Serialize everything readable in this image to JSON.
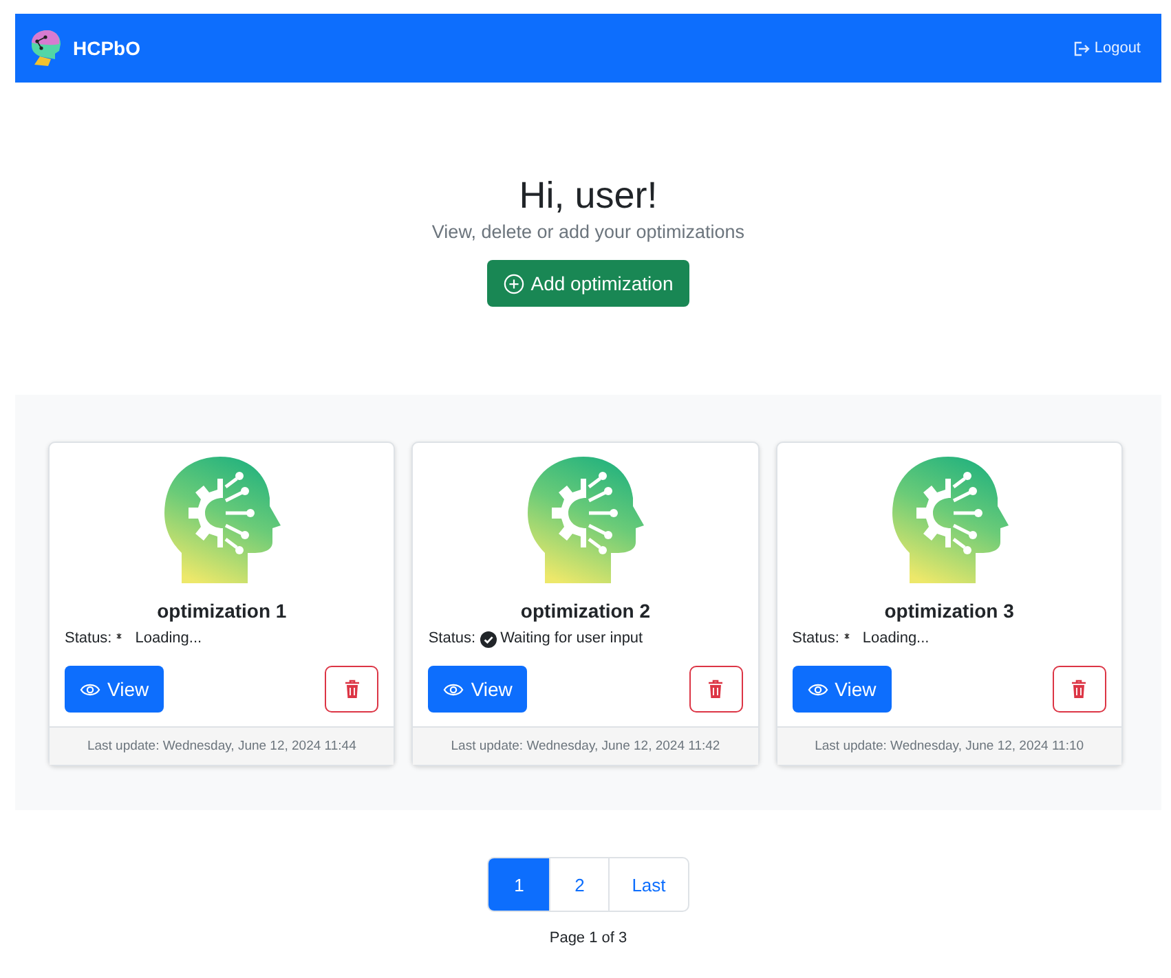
{
  "navbar": {
    "brand": "HCPbO",
    "logout": "Logout"
  },
  "header": {
    "title": "Hi, user!",
    "subtitle": "View, delete or add your optimizations",
    "add_button": "Add optimization"
  },
  "cards": [
    {
      "name": "optimization 1",
      "status_label": "Status:",
      "kind": "loading",
      "status": "Loading...",
      "view": "View",
      "updated": "Last update: Wednesday, June 12, 2024 11:44"
    },
    {
      "name": "optimization 2",
      "status_label": "Status:",
      "kind": "done",
      "status": "Waiting for user input",
      "view": "View",
      "updated": "Last update: Wednesday, June 12, 2024 11:42"
    },
    {
      "name": "optimization 3",
      "status_label": "Status:",
      "kind": "loading",
      "status": "Loading...",
      "view": "View",
      "updated": "Last update: Wednesday, June 12, 2024 11:10"
    }
  ],
  "pagination": {
    "pages": [
      {
        "label": "1",
        "selected": true
      },
      {
        "label": "2",
        "selected": false
      },
      {
        "label": "Last",
        "selected": false
      }
    ],
    "info": "Page 1 of 3"
  }
}
